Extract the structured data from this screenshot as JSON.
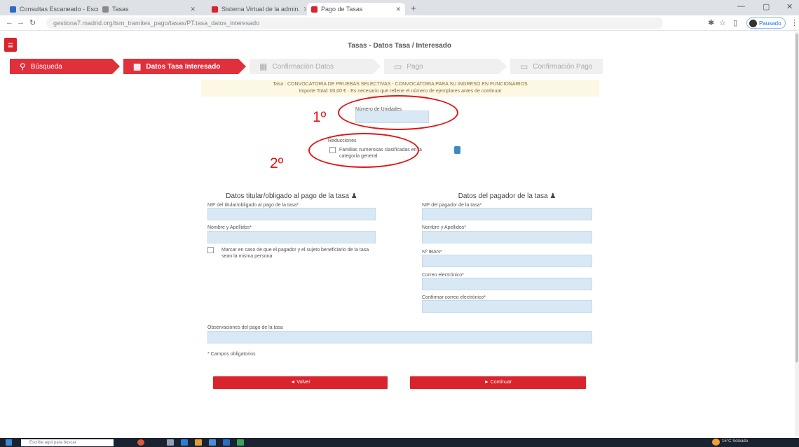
{
  "browser": {
    "tabs": [
      {
        "title": "Consultas Escaneado - Escr.",
        "fav_color": "#2b6cc4"
      },
      {
        "title": "Tasas",
        "fav_color": "#8a8a8a"
      },
      {
        "title": "Sistema Virtual de la admin.",
        "fav_color": "#d9232d"
      },
      {
        "title": "Pago de Tasas",
        "fav_color": "#d9232d"
      }
    ],
    "new_tab": "+",
    "url": "gestiona7.madrid.org/tsm_tramites_pago/tasas/PT.tasa_datos_interesado",
    "profile_label": "Pausado"
  },
  "app": {
    "title": "Tasas - Datos Tasa / Interesado",
    "steps": [
      {
        "label": "Búsqueda",
        "icon": "🔍"
      },
      {
        "label": "Datos Tasa Interesado",
        "icon": "▦"
      },
      {
        "label": "Confirmación Datos",
        "icon": "▦✓"
      },
      {
        "label": "Pago",
        "icon": "▭"
      },
      {
        "label": "Confirmación Pago",
        "icon": "▭✓"
      }
    ],
    "banner_line1": "Tasa : CONVOCATORIA DE PRUEBAS SELECTIVAS - CONVOCATORIA PARA SU INGRESO EN FUNCIONARIOS",
    "banner_line2": "Importe Total: 00,00 € · Es necesario que rellene el número de ejemplares antes de continuar",
    "unidades_label": "Número de Unidades",
    "reducciones_label": "Reducciones",
    "reduccion_checkbox_label": "Familias numerosas clasificadas en la categoría general"
  },
  "form": {
    "left_heading": "Datos titular/obligado al pago de la tasa",
    "right_heading": "Datos del pagador de la tasa",
    "left_fields": [
      "NIF del titular/obligado al pago de la tasa*",
      "Nombre y Apellidos*"
    ],
    "same_person_label": "Marcar en caso de que el pagador y el sujeto beneficiario de la tasa sean la misma persona",
    "right_fields": [
      "NIF del pagador de la tasa*",
      "Nombre y Apellidos*",
      "Nº IBAN*",
      "Correo electrónico*",
      "Confirmar correo electrónico*"
    ],
    "observaciones_label": "Observaciones del pago de la tasa",
    "required_note": "* Campos obligatorios",
    "back_button": "◄ Volver",
    "continue_button": "► Continuar"
  },
  "annotations": {
    "first": "1º",
    "second": "2º"
  },
  "taskbar": {
    "search_placeholder": "Escribe aquí para buscar",
    "weather": "15°C Soleado"
  }
}
